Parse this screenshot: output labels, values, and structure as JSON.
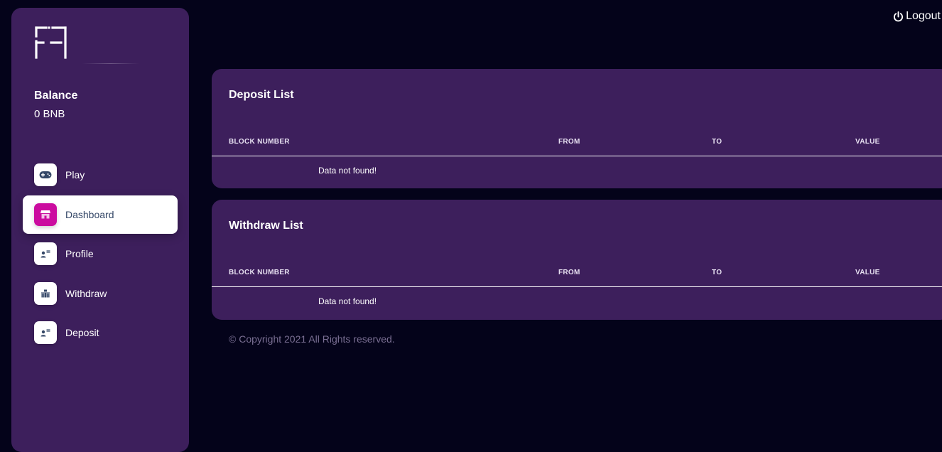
{
  "sidebar": {
    "balance_title": "Balance",
    "balance_value": "0 BNB",
    "items": [
      {
        "label": "Play",
        "icon": "gamepad-icon",
        "active": false
      },
      {
        "label": "Dashboard",
        "icon": "shop-icon",
        "active": true
      },
      {
        "label": "Profile",
        "icon": "user-card-icon",
        "active": false
      },
      {
        "label": "Withdraw",
        "icon": "bank-icon",
        "active": false
      },
      {
        "label": "Deposit",
        "icon": "user-card-icon",
        "active": false
      }
    ]
  },
  "header": {
    "logout_label": "Logout"
  },
  "deposit_list": {
    "title": "Deposit List",
    "columns": [
      "BLOCK NUMBER",
      "FROM",
      "TO",
      "VALUE"
    ],
    "empty_message": "Data not found!"
  },
  "withdraw_list": {
    "title": "Withdraw List",
    "columns": [
      "BLOCK NUMBER",
      "FROM",
      "TO",
      "VALUE"
    ],
    "empty_message": "Data not found!"
  },
  "footer": {
    "copyright": "© Copyright 2021 All Rights reserved."
  },
  "colors": {
    "background": "#04031a",
    "panel": "#3d1f5c",
    "accent": "#cb0c9f"
  }
}
